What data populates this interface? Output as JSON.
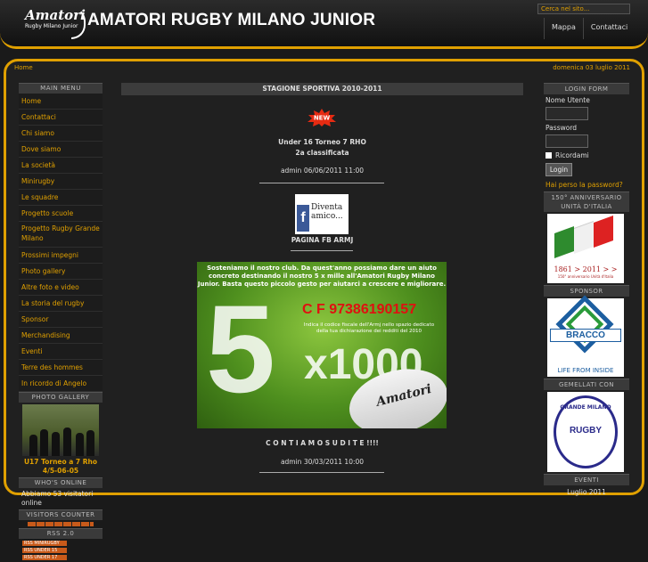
{
  "header": {
    "logo_text": "Amatori",
    "logo_subtext": "Rugby Milano Junior",
    "site_title": "AMATORI RUGBY MILANO JUNIOR",
    "search_placeholder": "Cerca nel sito...",
    "nav": [
      "Mappa",
      "Contattaci"
    ]
  },
  "breadcrumb": "Home",
  "date": "domenica 03 luglio 2011",
  "sidebar": {
    "menu_heading": "MAIN MENU",
    "menu": [
      "Home",
      "Contattaci",
      "Chi siamo",
      "Dove siamo",
      "La società",
      "Minirugby",
      "Le squadre",
      "Progetto scuole",
      "Progetto Rugby Grande Milano",
      "Prossimi impegni",
      "Photo gallery",
      "Altre foto e video",
      "La storia del rugby",
      "Sponsor",
      "Merchandising",
      "Eventi",
      "Terre des hommes",
      "In ricordo di Angelo"
    ],
    "gallery_heading": "PHOTO GALLERY",
    "gallery_caption": "U17 Torneo a 7 Rho 4/5-06-05",
    "online_heading": "WHO'S ONLINE",
    "online_text": "Abbiamo 53 visitatori online",
    "counter_heading": "VISITORS COUNTER",
    "rss_heading": "RSS 2.0",
    "rss_badges": [
      "RSS MINIRUGBY",
      "RSS UNDER 15",
      "RSS UNDER 17"
    ]
  },
  "main": {
    "heading": "STAGIONE SPORTIVA 2010-2011",
    "new_badge": "NEW",
    "item1_title": "Under 16 Torneo 7 RHO",
    "item1_sub": "2a classificata",
    "item1_meta": "admin 06/06/2011 11:00",
    "fb_text": "Diventa amico...",
    "fb_caption": "PAGINA FB ARMJ",
    "promo_text": "Sosteniamo il nostro club. Da quest'anno possiamo dare un aiuto concreto destinando il nostro 5 x mille all'Amatori Rugby Milano Junior. Basta questo piccolo gesto per aiutarci a crescere e migliorare.",
    "promo_cf": "C F 97386190157",
    "promo_small": "Indica il codice fiscale dell'Armj nello spazio dedicato della tua dichiarazione dei redditi del 2010",
    "promo_big": "5",
    "promo_x1000": "x1000",
    "promo_ball": "Amatori",
    "item2_title": "C O N T I A M O   S U   D I   T E !!!!",
    "item2_meta": "admin 30/03/2011 10:00"
  },
  "right": {
    "login_heading": "LOGIN FORM",
    "user_label": "Nome Utente",
    "pass_label": "Password",
    "remember": "Ricordami",
    "login_btn": "Login",
    "lost": "Hai perso la password?",
    "anniv_heading": "150° ANNIVERSARIO UNITÀ D'ITALIA",
    "anniv_years": "1861 > 2011 > >",
    "anniv_small": "150° anniversario Unità d'Italia",
    "sponsor_heading": "SPONSOR",
    "sponsor_name": "BRACCO",
    "sponsor_tag": "LIFE FROM INSIDE",
    "twinned_heading": "GEMELLATI CON",
    "twinned_arc": "GRANDE MILANO",
    "twinned_name": "RUGBY",
    "events_heading": "EVENTI",
    "month": "Luglio 2011"
  }
}
